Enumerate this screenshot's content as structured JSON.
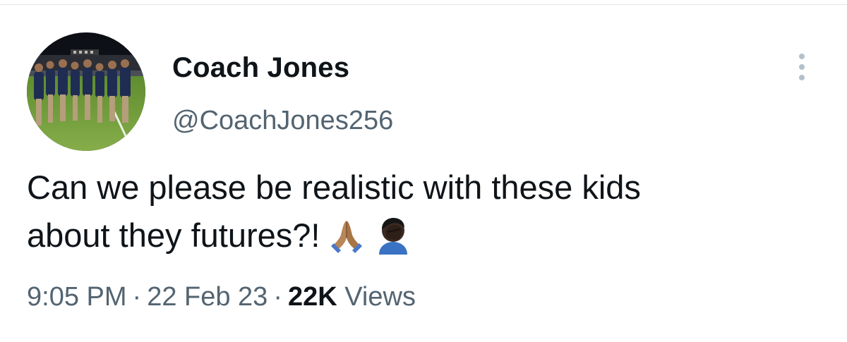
{
  "author": {
    "display_name": "Coach Jones",
    "handle": "@CoachJones256",
    "avatar_icon": "team-photo-avatar"
  },
  "menu": {
    "icon": "more-dots-vertical-icon"
  },
  "tweet": {
    "text_line1": "Can we please be realistic with these kids",
    "text_line2": "about they futures?!",
    "emojis": [
      "folded-hands-emoji",
      "person-facepalming-emoji"
    ]
  },
  "meta": {
    "time": "9:05 PM",
    "separator": "·",
    "date": "22 Feb 23",
    "views_count": "22K",
    "views_label": "Views"
  },
  "colors": {
    "text_primary": "#0f1419",
    "text_secondary": "#536471",
    "divider": "#dfe6ea"
  }
}
